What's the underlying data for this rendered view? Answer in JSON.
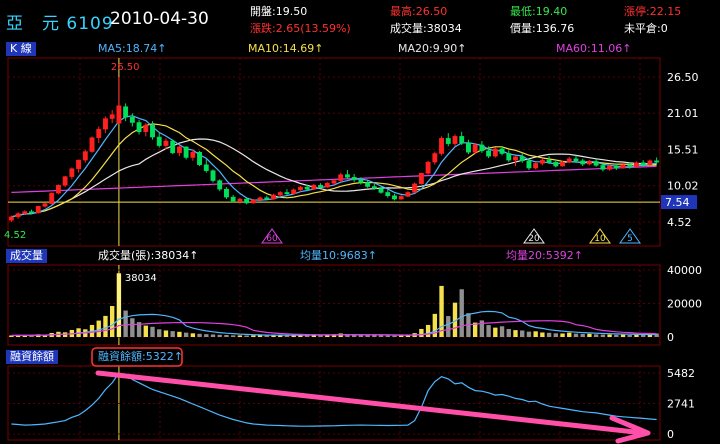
{
  "header": {
    "stock_name": "亞　元",
    "stock_code": "6109",
    "date": "2010-04-30",
    "open": "開盤:19.50",
    "high": "最高:26.50",
    "low": "最低:19.40",
    "upper_limit": "漲停:22.15",
    "change": "漲跌:2.65(13.59%)",
    "volume": "成交量:38034",
    "amount": "價量:136.76",
    "open_interest": "未平倉:0"
  },
  "kline_panel": {
    "label": "K 線",
    "ma5": "MA5:18.74↑",
    "ma10": "MA10:14.69↑",
    "ma20": "MA20:9.90↑",
    "ma60": "MA60:11.06↑",
    "peak_label": "26.50",
    "low_label": "4.52",
    "price_marker": "7.54",
    "y_ticks": [
      "26.50",
      "21.01",
      "15.51",
      "10.02",
      "4.52"
    ],
    "markers": [
      "60",
      "20",
      "10",
      "5"
    ]
  },
  "volume_panel": {
    "label": "成交量",
    "volume_legend": "成交量(張):38034↑",
    "ma10": "均量10:9683↑",
    "ma20": "均量20:5392↑",
    "peak_label": "38034",
    "y_ticks": [
      "40000",
      "20000",
      "0"
    ]
  },
  "margin_panel": {
    "label": "融資餘額",
    "legend": "融資餘額:5322↑",
    "y_ticks": [
      "5482",
      "2741",
      "0"
    ]
  },
  "colors": {
    "up": "#ff2020",
    "down": "#00e05a",
    "ma5": "#4fb6ff",
    "ma10": "#f4e04a",
    "ma20": "#e8e8e8",
    "ma60": "#e040e0",
    "panel_tag": "#1f36b8",
    "highlight_box": "#ff3030",
    "arrow": "#ff4fa8"
  },
  "chart_data": [
    {
      "type": "candlestick",
      "ylim": [
        4.52,
        26.5
      ],
      "series": [
        {
          "name": "MA5",
          "value": 18.74
        },
        {
          "name": "MA10",
          "value": 14.69
        },
        {
          "name": "MA20",
          "value": 9.9
        },
        {
          "name": "MA60",
          "value": 11.06
        }
      ],
      "ohlc": [
        [
          4.8,
          5.5,
          4.52,
          5.3
        ],
        [
          5.3,
          6.0,
          5.0,
          5.8
        ],
        [
          5.8,
          6.3,
          5.6,
          6.1
        ],
        [
          6.1,
          6.4,
          5.7,
          5.9
        ],
        [
          5.9,
          7.0,
          5.8,
          6.9
        ],
        [
          6.9,
          7.5,
          6.7,
          7.3
        ],
        [
          7.3,
          9.0,
          7.2,
          8.9
        ],
        [
          8.9,
          10.2,
          8.7,
          10.1
        ],
        [
          10.1,
          11.5,
          9.8,
          11.4
        ],
        [
          11.4,
          12.8,
          11.0,
          12.6
        ],
        [
          12.6,
          14.0,
          12.0,
          13.9
        ],
        [
          13.9,
          15.5,
          13.5,
          15.2
        ],
        [
          15.2,
          17.5,
          15.0,
          17.3
        ],
        [
          17.3,
          19.0,
          16.5,
          18.6
        ],
        [
          18.6,
          20.5,
          18.0,
          20.2
        ],
        [
          20.2,
          21.5,
          19.5,
          20.8
        ],
        [
          19.5,
          26.5,
          19.4,
          22.15
        ],
        [
          22.0,
          22.5,
          19.8,
          20.4
        ],
        [
          20.4,
          21.0,
          19.0,
          19.6
        ],
        [
          19.6,
          20.0,
          17.8,
          18.2
        ],
        [
          18.2,
          19.5,
          17.5,
          19.2
        ],
        [
          19.2,
          19.8,
          17.0,
          17.4
        ],
        [
          17.4,
          18.0,
          15.8,
          16.1
        ],
        [
          16.1,
          17.2,
          15.5,
          16.8
        ],
        [
          16.8,
          17.0,
          14.8,
          15.0
        ],
        [
          15.0,
          16.2,
          14.5,
          15.9
        ],
        [
          15.9,
          16.0,
          14.0,
          14.3
        ],
        [
          14.3,
          15.5,
          13.8,
          15.1
        ],
        [
          15.1,
          15.3,
          13.0,
          13.2
        ],
        [
          13.2,
          14.0,
          12.0,
          12.3
        ],
        [
          12.3,
          12.5,
          10.5,
          10.8
        ],
        [
          10.8,
          11.0,
          9.2,
          9.5
        ],
        [
          9.5,
          9.8,
          8.0,
          8.3
        ],
        [
          8.3,
          8.6,
          7.5,
          7.7
        ],
        [
          7.7,
          8.2,
          7.3,
          8.0
        ],
        [
          8.0,
          8.1,
          7.2,
          7.4
        ],
        [
          7.4,
          8.0,
          7.3,
          7.9
        ],
        [
          7.9,
          8.4,
          7.6,
          8.2
        ],
        [
          8.2,
          8.5,
          7.8,
          8.0
        ],
        [
          8.0,
          8.8,
          7.9,
          8.6
        ],
        [
          8.6,
          9.2,
          8.4,
          9.0
        ],
        [
          9.0,
          9.5,
          8.6,
          8.8
        ],
        [
          8.8,
          9.6,
          8.7,
          9.4
        ],
        [
          9.4,
          10.0,
          9.1,
          9.8
        ],
        [
          9.8,
          10.2,
          9.3,
          9.5
        ],
        [
          9.5,
          10.3,
          9.4,
          10.1
        ],
        [
          10.1,
          10.4,
          9.6,
          9.8
        ],
        [
          9.8,
          10.6,
          9.7,
          10.4
        ],
        [
          10.4,
          11.0,
          10.1,
          10.8
        ],
        [
          10.8,
          12.0,
          10.6,
          11.7
        ],
        [
          11.7,
          12.4,
          11.0,
          11.3
        ],
        [
          11.3,
          11.8,
          10.6,
          10.9
        ],
        [
          10.9,
          11.3,
          10.2,
          10.5
        ],
        [
          10.5,
          10.8,
          9.7,
          9.9
        ],
        [
          9.9,
          10.3,
          9.4,
          9.6
        ],
        [
          9.6,
          9.9,
          8.8,
          9.0
        ],
        [
          9.0,
          9.4,
          8.2,
          8.5
        ],
        [
          8.5,
          8.8,
          7.8,
          8.0
        ],
        [
          8.0,
          8.6,
          7.9,
          8.4
        ],
        [
          8.4,
          9.2,
          8.3,
          9.0
        ],
        [
          9.0,
          10.5,
          8.9,
          10.3
        ],
        [
          10.3,
          12.0,
          10.2,
          11.9
        ],
        [
          11.9,
          13.8,
          11.7,
          13.6
        ],
        [
          13.6,
          15.2,
          13.2,
          14.9
        ],
        [
          14.9,
          17.5,
          14.6,
          17.2
        ],
        [
          17.2,
          18.0,
          16.0,
          16.4
        ],
        [
          16.4,
          17.8,
          16.0,
          17.5
        ],
        [
          17.5,
          18.2,
          16.2,
          16.5
        ],
        [
          16.5,
          17.0,
          14.8,
          15.1
        ],
        [
          15.1,
          16.5,
          14.8,
          16.2
        ],
        [
          16.2,
          16.8,
          15.0,
          15.3
        ],
        [
          15.3,
          16.0,
          14.2,
          14.5
        ],
        [
          14.5,
          15.8,
          14.3,
          15.6
        ],
        [
          15.6,
          16.0,
          14.6,
          14.9
        ],
        [
          14.9,
          15.4,
          13.6,
          13.9
        ],
        [
          13.9,
          14.6,
          13.0,
          14.4
        ],
        [
          14.4,
          15.0,
          13.5,
          13.8
        ],
        [
          13.8,
          14.2,
          12.4,
          12.7
        ],
        [
          12.7,
          13.6,
          12.5,
          13.4
        ],
        [
          13.4,
          14.2,
          13.1,
          13.9
        ],
        [
          13.9,
          14.5,
          13.3,
          13.6
        ],
        [
          13.6,
          14.0,
          12.8,
          13.0
        ],
        [
          13.0,
          13.8,
          12.9,
          13.6
        ],
        [
          13.6,
          14.4,
          13.4,
          14.1
        ],
        [
          14.1,
          14.6,
          13.5,
          13.8
        ],
        [
          13.8,
          14.1,
          13.0,
          13.3
        ],
        [
          13.3,
          13.9,
          13.1,
          13.7
        ],
        [
          13.7,
          14.0,
          12.9,
          13.1
        ],
        [
          13.1,
          13.3,
          12.2,
          12.5
        ],
        [
          12.5,
          13.2,
          12.3,
          13.0
        ],
        [
          13.0,
          13.4,
          12.4,
          12.7
        ],
        [
          12.7,
          13.5,
          12.6,
          13.2
        ],
        [
          13.2,
          13.6,
          12.6,
          12.9
        ],
        [
          12.9,
          13.7,
          12.8,
          13.5
        ],
        [
          13.5,
          13.9,
          12.9,
          13.2
        ],
        [
          13.2,
          14.0,
          13.1,
          13.8
        ],
        [
          13.8,
          14.3,
          13.3,
          13.6
        ]
      ]
    },
    {
      "type": "bar",
      "ylim": [
        0,
        40000
      ],
      "series": [
        {
          "name": "成交量(張)",
          "value": 38034
        },
        {
          "name": "均量10",
          "value": 9683
        },
        {
          "name": "均量20",
          "value": 5392
        }
      ],
      "values": [
        900,
        1100,
        800,
        1300,
        1600,
        1200,
        2400,
        3100,
        2800,
        4200,
        5200,
        4600,
        7200,
        9800,
        12600,
        18500,
        38034,
        15800,
        11200,
        8900,
        6800,
        6100,
        4600,
        3900,
        3500,
        3100,
        2600,
        2200,
        1900,
        1700,
        1500,
        1300,
        1200,
        1000,
        950,
        900,
        1000,
        1100,
        950,
        1200,
        1400,
        1100,
        1300,
        1500,
        1100,
        1200,
        1000,
        1400,
        1600,
        2100,
        1500,
        1200,
        1100,
        1000,
        900,
        900,
        850,
        800,
        950,
        1300,
        2300,
        4800,
        7200,
        13800,
        30500,
        12500,
        20500,
        28500,
        14200,
        8600,
        9900,
        7100,
        5600,
        6400,
        4800,
        4100,
        3900,
        3200,
        3400,
        2700,
        2500,
        2200,
        2100,
        2600,
        2000,
        1800,
        1900,
        1600,
        1400,
        1500,
        1300,
        1400,
        1200,
        1500,
        1300,
        1700,
        2100
      ]
    },
    {
      "type": "line",
      "ylim": [
        0,
        5482
      ],
      "series": [
        {
          "name": "融資餘額",
          "value": 5322
        }
      ],
      "values": [
        900,
        850,
        800,
        820,
        850,
        900,
        1000,
        1100,
        1200,
        1500,
        1700,
        2100,
        2600,
        3200,
        4000,
        4600,
        5482,
        5350,
        4900,
        4600,
        4300,
        4000,
        3800,
        3600,
        3400,
        3200,
        2950,
        2700,
        2450,
        2200,
        1950,
        1700,
        1500,
        1300,
        1150,
        1000,
        900,
        850,
        800,
        780,
        760,
        740,
        720,
        700,
        700,
        710,
        720,
        730,
        740,
        760,
        780,
        790,
        800,
        790,
        780,
        770,
        760,
        770,
        780,
        800,
        1200,
        2400,
        3900,
        4700,
        5150,
        4950,
        4500,
        4600,
        4200,
        3900,
        3850,
        3700,
        3500,
        3550,
        3400,
        3200,
        3100,
        2900,
        2950,
        2700,
        2500,
        2400,
        2300,
        2200,
        2100,
        2000,
        1950,
        1900,
        1800,
        1700,
        1600,
        1550,
        1500,
        1450,
        1400,
        1350,
        1300
      ]
    }
  ]
}
